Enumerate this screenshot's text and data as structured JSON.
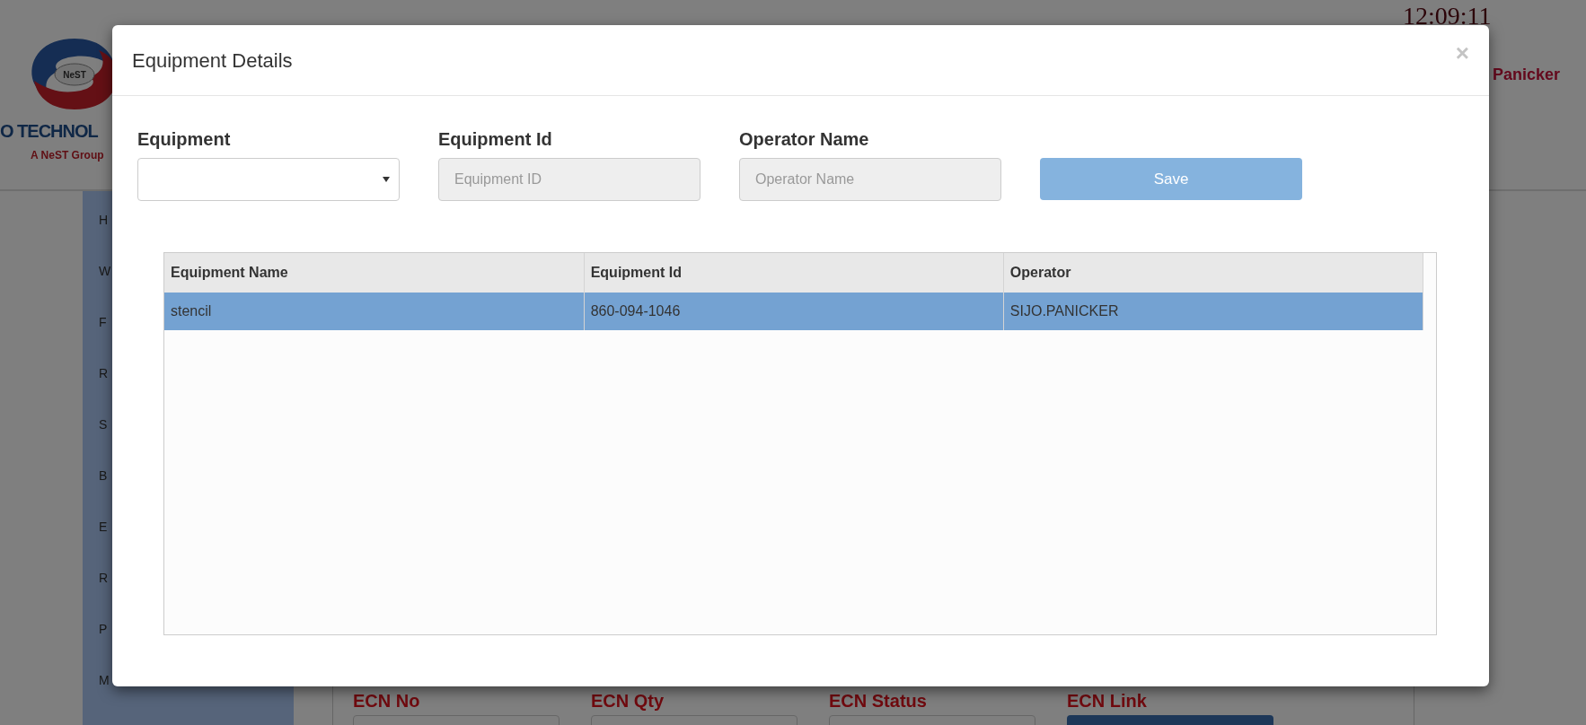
{
  "page": {
    "logo": {
      "mark": "NeST",
      "name": "O TECHNOL",
      "tagline": "A NeST Group"
    },
    "clock": "12:09:11",
    "user": "Panicker",
    "sidebar": {
      "items": [
        "H",
        "W",
        "F",
        "R",
        "S",
        "B",
        "E",
        "R",
        "P",
        "M"
      ]
    },
    "ecn_fields": [
      {
        "label": "ECN No",
        "kind": "input"
      },
      {
        "label": "ECN Qty",
        "kind": "input"
      },
      {
        "label": "ECN Status",
        "kind": "input"
      },
      {
        "label": "ECN Link",
        "kind": "button"
      }
    ]
  },
  "modal": {
    "title": "Equipment Details",
    "close": "×",
    "fields": [
      {
        "kind": "select",
        "label": "Equipment",
        "disabled": false
      },
      {
        "kind": "text",
        "label": "Equipment Id",
        "placeholder": "Equipment ID",
        "disabled": true
      },
      {
        "kind": "text",
        "label": "Operator Name",
        "placeholder": "Operator Name",
        "disabled": true
      }
    ],
    "save_button": {
      "label": "Save",
      "disabled": true
    },
    "table": {
      "columns": [
        "Equipment Name",
        "Equipment Id",
        "Operator"
      ],
      "rows": [
        {
          "cells": [
            "stencil",
            "860-094-1046",
            "SIJO.PANICKER"
          ],
          "selected": true
        }
      ]
    }
  }
}
